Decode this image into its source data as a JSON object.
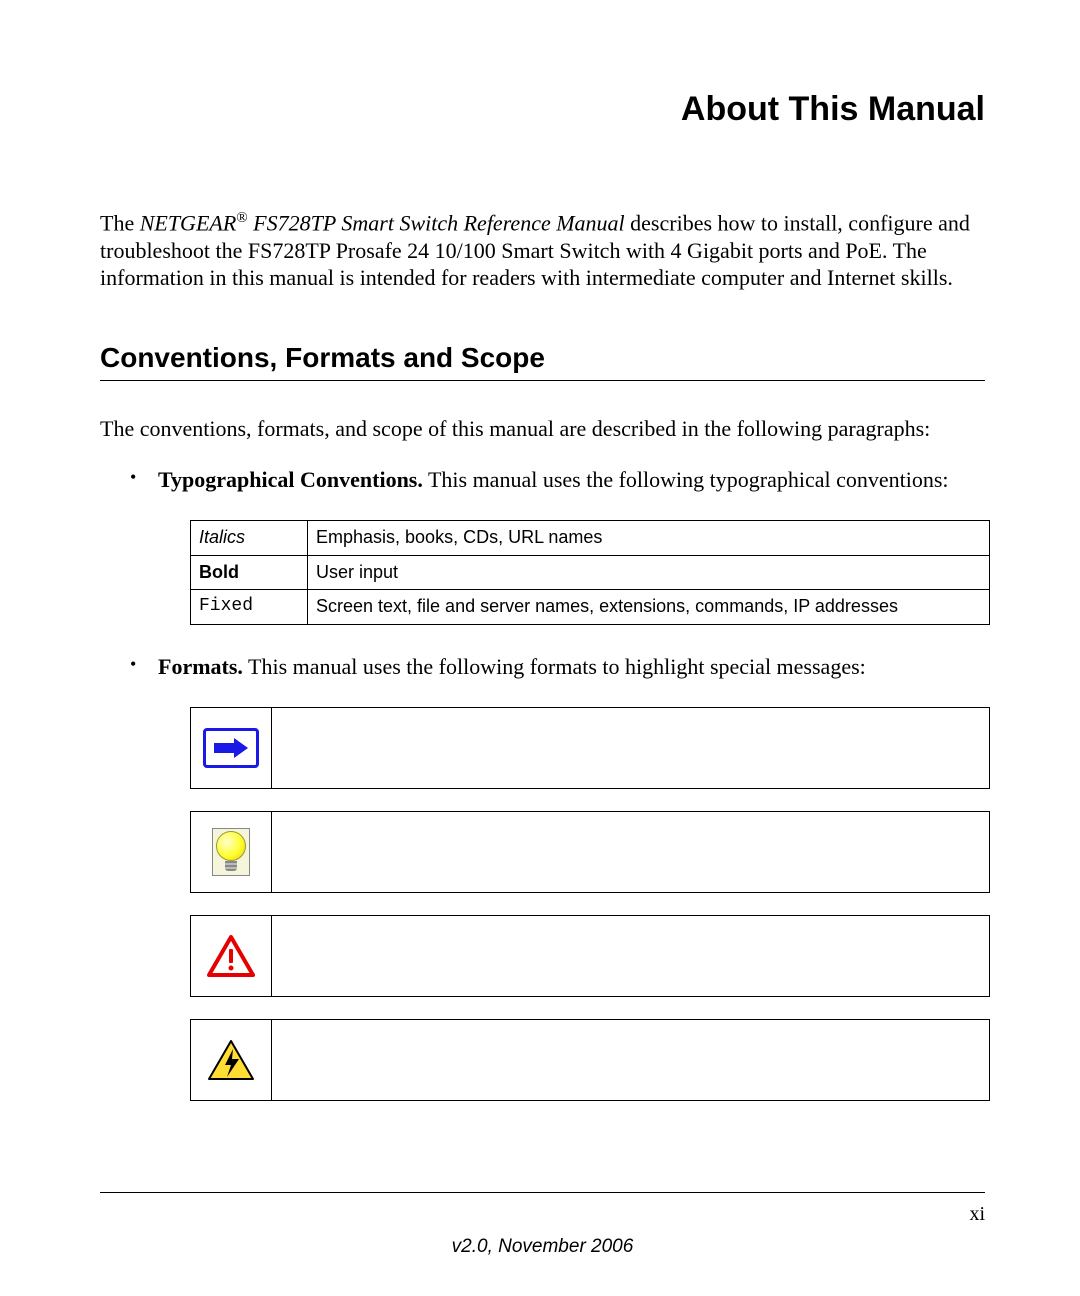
{
  "title": "About This Manual",
  "intro": {
    "prefix": "The ",
    "italic_title": "NETGEAR",
    "registered": "®",
    "italic_title_rest": " FS728TP Smart Switch Reference Manual",
    "body": " describes how to install, configure and troubleshoot the FS728TP Prosafe 24 10/100 Smart Switch with 4 Gigabit ports and PoE. The information in this manual is intended for readers with intermediate computer and Internet skills."
  },
  "section_heading": "Conventions, Formats and Scope",
  "section_lead": "The conventions, formats, and scope of this manual are described in the following paragraphs:",
  "bullets": {
    "typo_bold": "Typographical Conventions.",
    "typo_rest": " This manual uses the following typographical conventions:",
    "formats_bold": "Formats.",
    "formats_rest": " This manual uses the following formats to highlight special messages:"
  },
  "typo_table": [
    {
      "label": "Italics",
      "desc": "Emphasis, books, CDs, URL names",
      "style": "italic"
    },
    {
      "label": "Bold",
      "desc": "User input",
      "style": "bold"
    },
    {
      "label": "Fixed",
      "desc": "Screen text, file and server names, extensions, commands, IP addresses",
      "style": "fixed"
    }
  ],
  "footer": {
    "page": "xi",
    "version": "v2.0, November 2006"
  }
}
